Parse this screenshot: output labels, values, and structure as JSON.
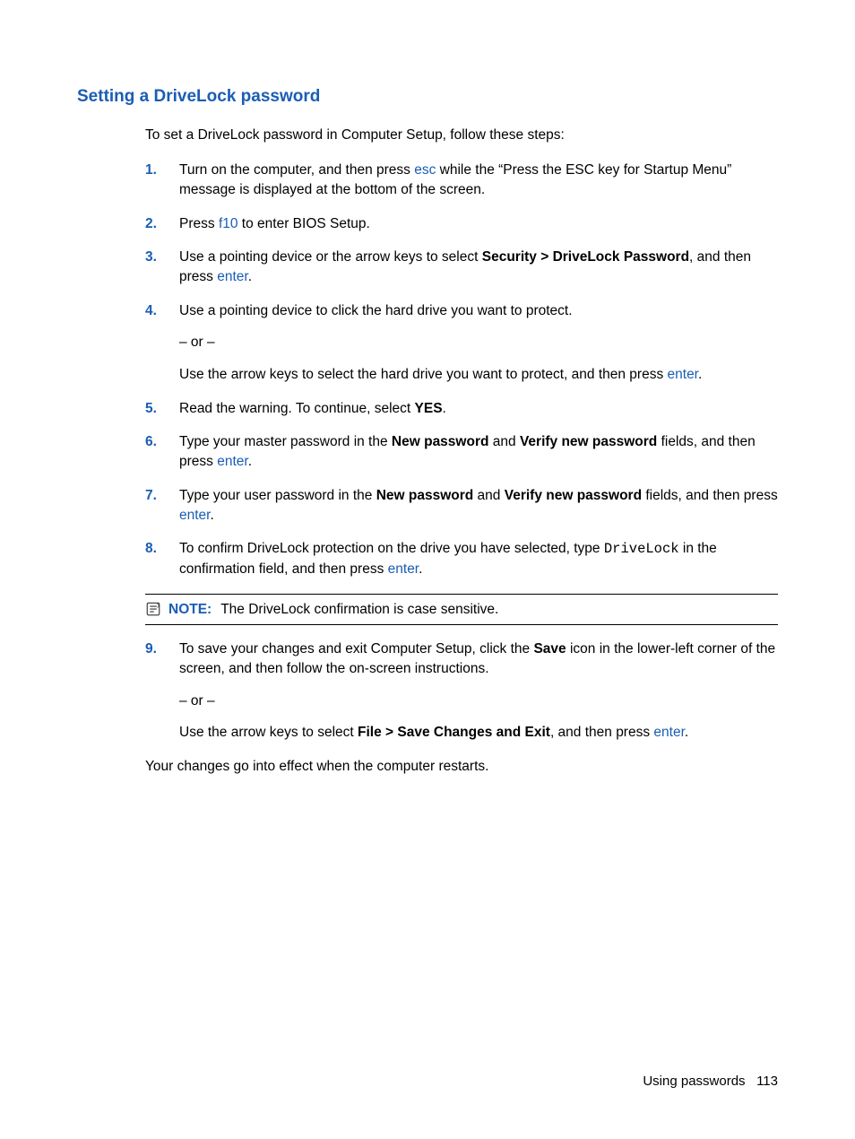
{
  "heading": "Setting a DriveLock password",
  "intro": "To set a DriveLock password in Computer Setup, follow these steps:",
  "steps": {
    "s1": {
      "num": "1.",
      "t1": "Turn on the computer, and then press ",
      "kw1": "esc",
      "t2": " while the “Press the ESC key for Startup Menu” message is displayed at the bottom of the screen."
    },
    "s2": {
      "num": "2.",
      "t1": "Press ",
      "kw1": "f10",
      "t2": " to enter BIOS Setup."
    },
    "s3": {
      "num": "3.",
      "t1": "Use a pointing device or the arrow keys to select ",
      "b1": "Security > DriveLock Password",
      "t2": ", and then press ",
      "kw1": "enter",
      "t3": "."
    },
    "s4": {
      "num": "4.",
      "t1": "Use a pointing device to click the hard drive you want to protect.",
      "or": "– or –",
      "t2": "Use the arrow keys to select the hard drive you want to protect, and then press ",
      "kw1": "enter",
      "t3": "."
    },
    "s5": {
      "num": "5.",
      "t1": "Read the warning. To continue, select ",
      "b1": "YES",
      "t2": "."
    },
    "s6": {
      "num": "6.",
      "t1": "Type your master password in the ",
      "b1": "New password",
      "t2": " and ",
      "b2": "Verify new password",
      "t3": " fields, and then press ",
      "kw1": "enter",
      "t4": "."
    },
    "s7": {
      "num": "7.",
      "t1": "Type your user password in the ",
      "b1": "New password",
      "t2": " and ",
      "b2": "Verify new password",
      "t3": " fields, and then press ",
      "kw1": "enter",
      "t4": "."
    },
    "s8": {
      "num": "8.",
      "t1": "To confirm DriveLock protection on the drive you have selected, type ",
      "code": "DriveLock",
      "t2": " in the confirmation field, and then press ",
      "kw1": "enter",
      "t3": "."
    },
    "s9": {
      "num": "9.",
      "t1": "To save your changes and exit Computer Setup, click the ",
      "b1": "Save",
      "t2": " icon in the lower-left corner of the screen, and then follow the on-screen instructions.",
      "or": "– or –",
      "t3": "Use the arrow keys to select ",
      "b2": "File > Save Changes and Exit",
      "t4": ", and then press ",
      "kw1": "enter",
      "t5": "."
    }
  },
  "note": {
    "label": "NOTE:",
    "text": "The DriveLock confirmation is case sensitive."
  },
  "closing": "Your changes go into effect when the computer restarts.",
  "footer": {
    "section": "Using passwords",
    "page": "113"
  }
}
